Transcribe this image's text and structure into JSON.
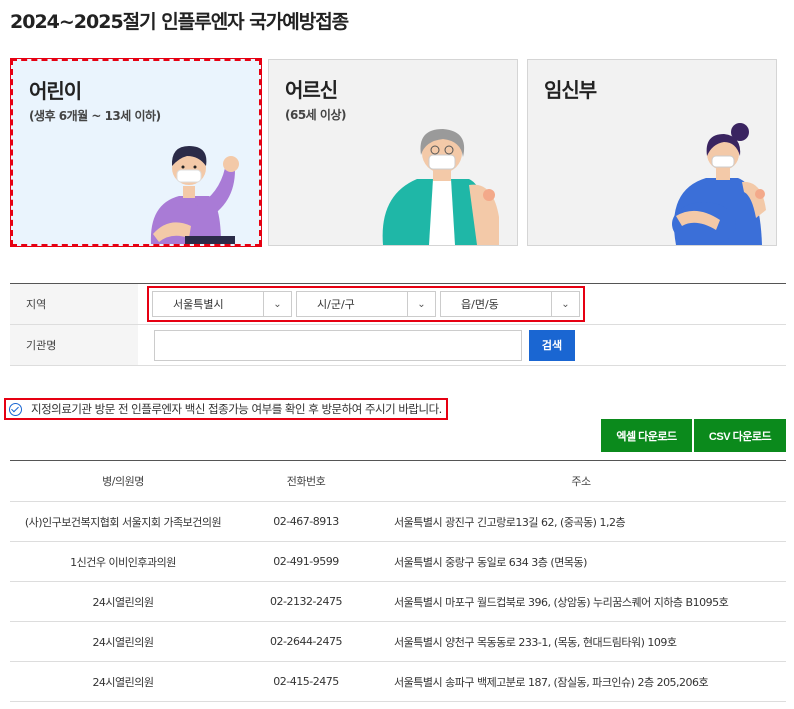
{
  "page": {
    "title": "2024~2025절기 인플루엔자 국가예방접종"
  },
  "cards": [
    {
      "title": "어린이",
      "subtitle": "(생후 6개월 ~ 13세 이하)"
    },
    {
      "title": "어르신",
      "subtitle": "(65세 이상)"
    },
    {
      "title": "임신부",
      "subtitle": ""
    }
  ],
  "filters": {
    "region_label": "지역",
    "region_selects": [
      "서울특별시",
      "시/군/구",
      "읍/면/동"
    ],
    "org_label": "기관명",
    "org_input_value": "",
    "search_label": "검색"
  },
  "notice": {
    "text": "지정의료기관 방문 전 인플루엔자 백신 접종가능 여부를 확인 후 방문하여 주시기 바랍니다."
  },
  "downloads": {
    "excel_label": "엑셀 다운로드",
    "csv_label": "CSV 다운로드"
  },
  "table": {
    "headers": [
      "병/의원명",
      "전화번호",
      "주소"
    ],
    "rows": [
      {
        "name": "(사)인구보건복지협회 서울지회 가족보건의원",
        "phone": "02-467-8913",
        "address": "서울특별시 광진구 긴고랑로13길 62, (중곡동) 1,2층"
      },
      {
        "name": "1신건우 이비인후과의원",
        "phone": "02-491-9599",
        "address": "서울특별시 중랑구 동일로 634 3층 (면목동)"
      },
      {
        "name": "24시열린의원",
        "phone": "02-2132-2475",
        "address": "서울특별시 마포구 월드컵북로 396, (상암동) 누리꿈스퀘어 지하층 B1095호"
      },
      {
        "name": "24시열린의원",
        "phone": "02-2644-2475",
        "address": "서울특별시 양천구 목동동로 233-1, (목동, 현대드림타워) 109호"
      },
      {
        "name": "24시열린의원",
        "phone": "02-415-2475",
        "address": "서울특별시 송파구 백제고분로 187, (잠실동, 파크인슈) 2층 205,206호"
      }
    ]
  },
  "colors": {
    "highlight": "#e60012",
    "search_button": "#1a66d2",
    "download_button": "#0b8a1c"
  }
}
